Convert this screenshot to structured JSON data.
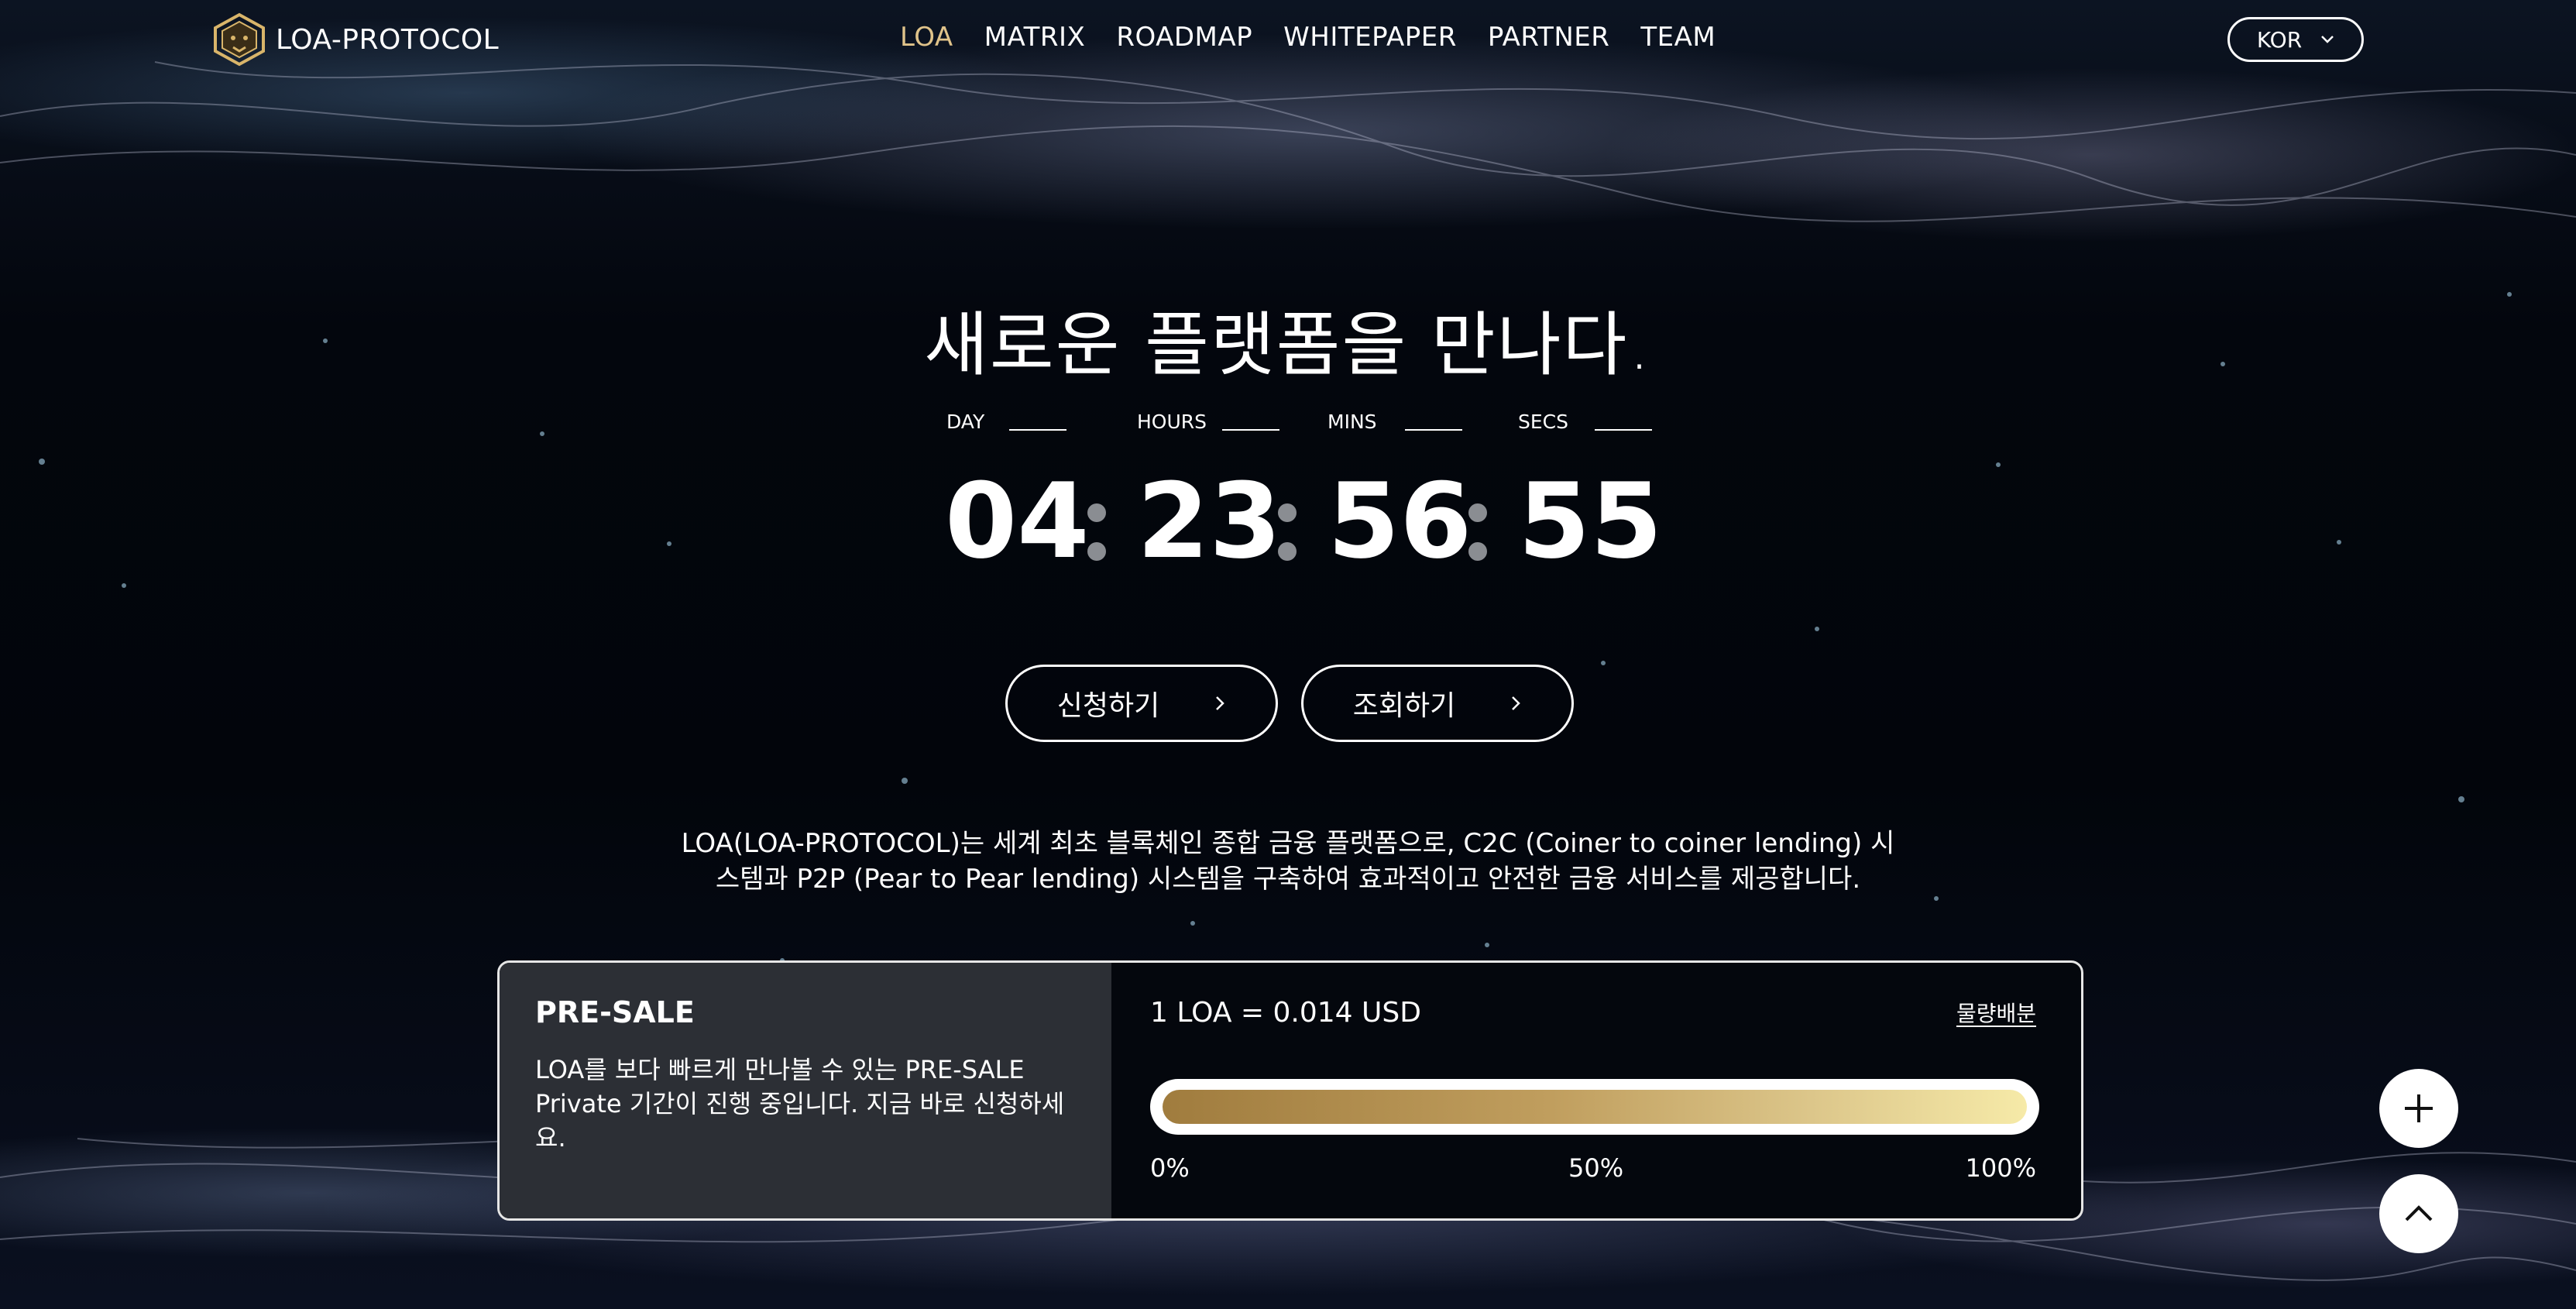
{
  "header": {
    "brand": "LOA-PROTOCOL",
    "nav": [
      "LOA",
      "MATRIX",
      "ROADMAP",
      "WHITEPAPER",
      "PARTNER",
      "TEAM"
    ],
    "active_nav": "LOA",
    "language": "KOR"
  },
  "hero": {
    "title": "새로운 플랫폼을 만나다.",
    "countdown": {
      "labels": [
        "DAY",
        "HOURS",
        "MINS",
        "SECS"
      ],
      "values": [
        "04",
        "23",
        "56",
        "55"
      ]
    },
    "buttons": {
      "apply": "신청하기",
      "inquiry": "조회하기"
    },
    "description_line1": "LOA(LOA-PROTOCOL)는 세계 최초 블록체인 종합 금융 플랫폼으로, C2C (Coiner to coiner lending) 시",
    "description_line2": "스템과 P2P (Pear to Pear lending) 시스템을 구축하여 효과적이고 안전한 금융 서비스를 제공합니다."
  },
  "presale": {
    "title": "PRE-SALE",
    "description": "LOA를 보다 빠르게 만나볼 수 있는 PRE-SALE Private 기간이 진행 중입니다. 지금 바로 신청하세요.",
    "price": "1 LOA = 0.014 USD",
    "allocation_link": "물량배분",
    "progress_fraction": 1.0,
    "ticks": [
      "0%",
      "50%",
      "100%"
    ]
  },
  "colors": {
    "accent_nav": "#e0c38a",
    "progress_start": "#a07c3e",
    "progress_end": "#f6eaa8",
    "card_panel": "#2c2f35"
  },
  "icons": [
    "loa-lion-logo-icon",
    "chevron-down-icon",
    "chevron-right-icon",
    "plus-icon",
    "chevron-up-icon"
  ]
}
